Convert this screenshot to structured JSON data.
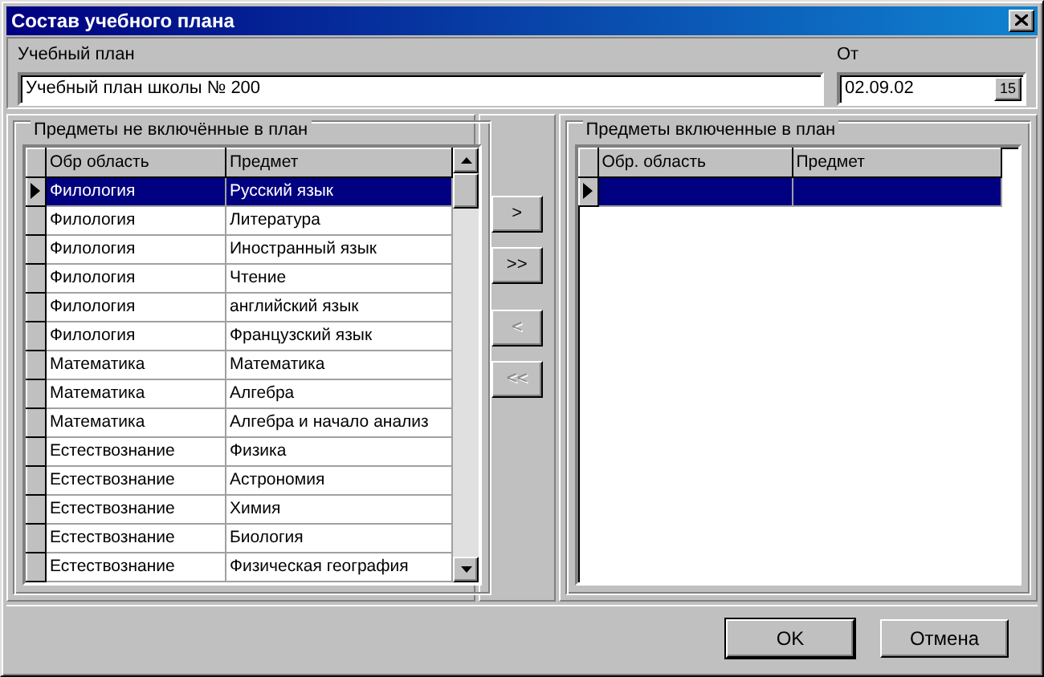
{
  "window": {
    "title": "Состав учебного плана"
  },
  "plan": {
    "label": "Учебный план",
    "value": "Учебный план школы № 200"
  },
  "date": {
    "label": "От",
    "value": "02.09.02",
    "button": "15"
  },
  "available": {
    "title": "Предметы не включённые в план",
    "columns": [
      "Обр область",
      "Предмет"
    ],
    "rows": [
      {
        "cells": [
          "Филология",
          "Русский язык"
        ],
        "selected": true
      },
      {
        "cells": [
          "Филология",
          "Литература"
        ],
        "selected": false
      },
      {
        "cells": [
          "Филология",
          "Иностранный язык"
        ],
        "selected": false
      },
      {
        "cells": [
          "Филология",
          "Чтение"
        ],
        "selected": false
      },
      {
        "cells": [
          "Филология",
          "английский язык"
        ],
        "selected": false
      },
      {
        "cells": [
          "Филология",
          "Французский язык"
        ],
        "selected": false
      },
      {
        "cells": [
          "Математика",
          "Математика"
        ],
        "selected": false
      },
      {
        "cells": [
          "Математика",
          "Алгебра"
        ],
        "selected": false
      },
      {
        "cells": [
          "Математика",
          "Алгебра и начало анализ"
        ],
        "selected": false
      },
      {
        "cells": [
          "Естествознание",
          "Физика"
        ],
        "selected": false
      },
      {
        "cells": [
          "Естествознание",
          "Астрономия"
        ],
        "selected": false
      },
      {
        "cells": [
          "Естествознание",
          "Химия"
        ],
        "selected": false
      },
      {
        "cells": [
          "Естествознание",
          "Биология"
        ],
        "selected": false
      },
      {
        "cells": [
          "Естествознание",
          "Физическая география"
        ],
        "selected": false
      }
    ]
  },
  "transfer_buttons": [
    {
      "label": ">",
      "disabled": false
    },
    {
      "label": ">>",
      "disabled": false
    },
    {
      "label": "<",
      "disabled": true
    },
    {
      "label": "<<",
      "disabled": true
    }
  ],
  "included": {
    "title": "Предметы включенные в план",
    "columns": [
      "Обр. область",
      "Предмет"
    ],
    "rows": [
      {
        "selected": true
      }
    ]
  },
  "buttons": [
    {
      "label": "OK",
      "default": true
    },
    {
      "label": "Отмена",
      "default": false
    }
  ]
}
